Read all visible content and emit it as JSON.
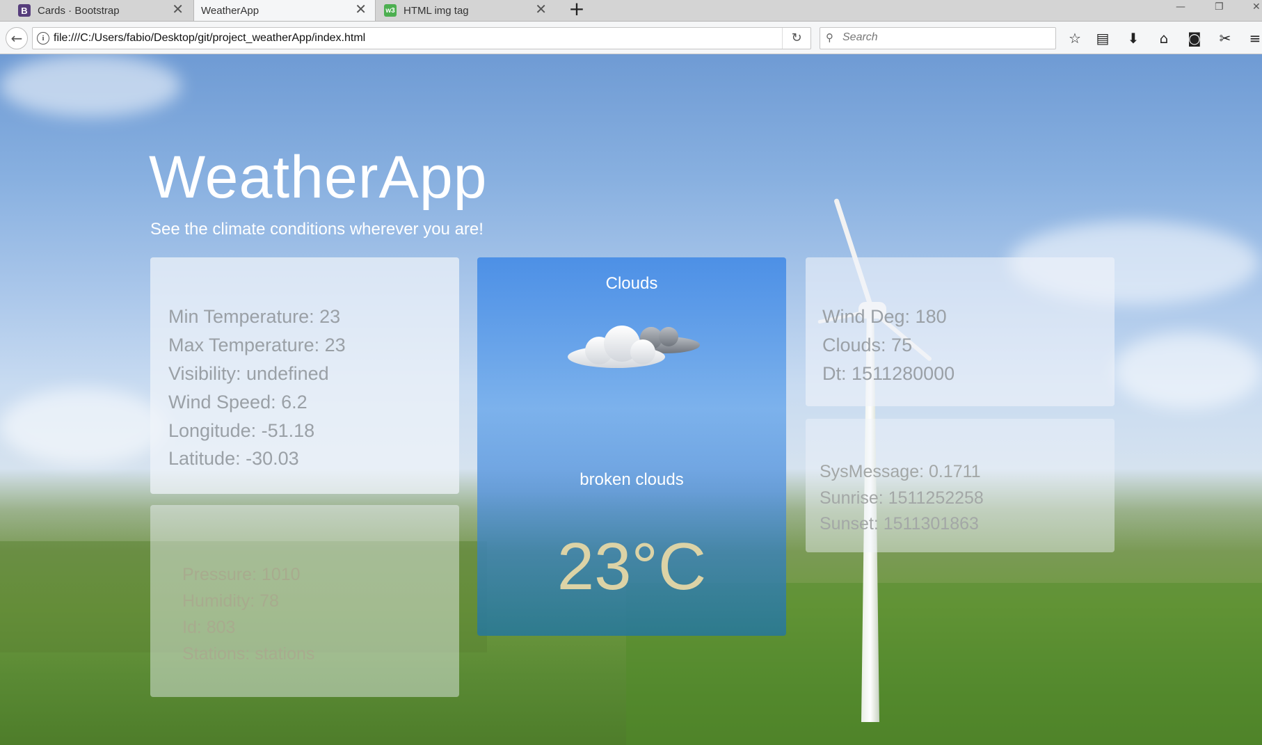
{
  "browser": {
    "tabs": [
      {
        "label": "Cards · Bootstrap",
        "favicon": "B",
        "favicon_color": "#563d7c",
        "active": false
      },
      {
        "label": "WeatherApp",
        "active": true
      },
      {
        "label": "HTML img tag",
        "favicon": "w3",
        "favicon_color": "#4caf50",
        "active": false
      }
    ],
    "url": "file:///C:/Users/fabio/Desktop/git/project_weatherApp/index.html",
    "search_placeholder": "Search",
    "icons": [
      "back-icon",
      "info-icon",
      "reload-icon",
      "search-icon",
      "bookmark-star-icon",
      "reader-list-icon",
      "download-icon",
      "home-icon",
      "pocket-icon",
      "extension-icon",
      "menu-icon"
    ]
  },
  "app": {
    "title": "WeatherApp",
    "subtitle": "See the climate conditions wherever you are!"
  },
  "card_left_top": [
    "Min Temperature: 23",
    "Max Temperature: 23",
    "Visibility: undefined",
    "Wind Speed: 6.2",
    "Longitude: -51.18",
    "Latitude: -30.03"
  ],
  "card_left_bottom": [
    "Pressure: 1010",
    "Humidity: 78",
    "Id: 803",
    "Stations: stations"
  ],
  "card_main": {
    "condition": "Clouds",
    "icon": "broken-clouds-icon",
    "description": "broken clouds",
    "temperature": "23°C"
  },
  "card_right_top": [
    "Wind Deg: 180",
    "Clouds: 75",
    "Dt: 1511280000"
  ],
  "card_right_bottom": [
    "SysMessage: 0.1711",
    "Sunrise: 1511252258",
    "Sunset: 1511301863"
  ],
  "colors": {
    "accent_card": "#4a8ee6",
    "temp_text": "#dcd3a6",
    "card_text": "#9aa0a6"
  }
}
